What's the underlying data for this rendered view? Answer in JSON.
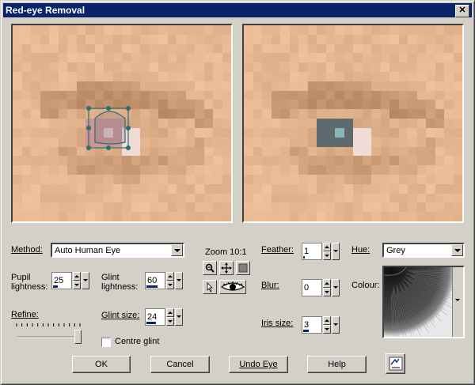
{
  "window": {
    "title": "Red-eye Removal",
    "close_glyph": "✕"
  },
  "method": {
    "label": "Method:",
    "value": "Auto Human Eye"
  },
  "pupil_lightness": {
    "label_line1": "Pupil",
    "label_line2": "lightness:",
    "value": "25",
    "level": 0.25
  },
  "glint_lightness": {
    "label_line1": "Glint",
    "label_line2": "lightness:",
    "value": "60",
    "level": 0.6
  },
  "glint_size": {
    "label": "Glint size:",
    "value": "24",
    "level": 0.5
  },
  "refine": {
    "label": "Refine:",
    "level": 1.0
  },
  "centre_glint": {
    "label": "Centre glint",
    "checked": false
  },
  "zoom": {
    "label": "Zoom 10:1"
  },
  "feather": {
    "label": "Feather:",
    "value": "1",
    "level": 0.1
  },
  "blur": {
    "label": "Blur:",
    "value": "0",
    "level": 0.0
  },
  "iris_size": {
    "label": "Iris size:",
    "value": "3",
    "level": 0.3
  },
  "hue": {
    "label": "Hue:",
    "value": "Grey"
  },
  "colour": {
    "label": "Colour:"
  },
  "buttons": {
    "ok": "OK",
    "cancel": "Cancel",
    "undo_eye": "Undo Eye",
    "help": "Help"
  },
  "icons": {
    "zoom_out": "zoom-out-icon",
    "pan": "pan-icon",
    "view": "view-icon",
    "select": "select-arrow-icon",
    "eye": "eye-icon",
    "proof": "proof-icon"
  },
  "colors": {
    "titlebar": "#0a246a",
    "face_base": "#e7b892",
    "iris": "#5f6a6e"
  }
}
